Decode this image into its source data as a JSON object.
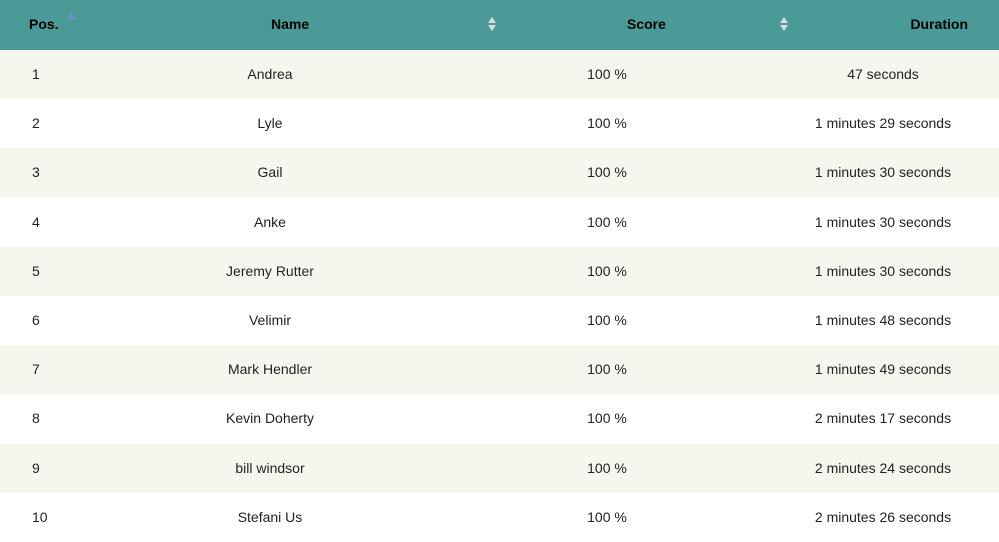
{
  "header": {
    "pos": "Pos.",
    "name": "Name",
    "score": "Score",
    "duration": "Duration"
  },
  "colors": {
    "header_bg": "#4a9a98",
    "row_alt_bg": "#f5f7ef",
    "sort_active": "#6f8fd6"
  },
  "rows": [
    {
      "pos": "1",
      "name": "Andrea",
      "score": "100 %",
      "duration": "47 seconds"
    },
    {
      "pos": "2",
      "name": "Lyle",
      "score": "100 %",
      "duration": "1 minutes 29 seconds"
    },
    {
      "pos": "3",
      "name": "Gail",
      "score": "100 %",
      "duration": "1 minutes 30 seconds"
    },
    {
      "pos": "4",
      "name": "Anke",
      "score": "100 %",
      "duration": "1 minutes 30 seconds"
    },
    {
      "pos": "5",
      "name": "Jeremy Rutter",
      "score": "100 %",
      "duration": "1 minutes 30 seconds"
    },
    {
      "pos": "6",
      "name": "Velimir",
      "score": "100 %",
      "duration": "1 minutes 48 seconds"
    },
    {
      "pos": "7",
      "name": "Mark Hendler",
      "score": "100 %",
      "duration": "1 minutes 49 seconds"
    },
    {
      "pos": "8",
      "name": "Kevin Doherty",
      "score": "100 %",
      "duration": "2 minutes 17 seconds"
    },
    {
      "pos": "9",
      "name": "bill windsor",
      "score": "100 %",
      "duration": "2 minutes 24 seconds"
    },
    {
      "pos": "10",
      "name": "Stefani Us",
      "score": "100 %",
      "duration": "2 minutes 26 seconds"
    }
  ]
}
